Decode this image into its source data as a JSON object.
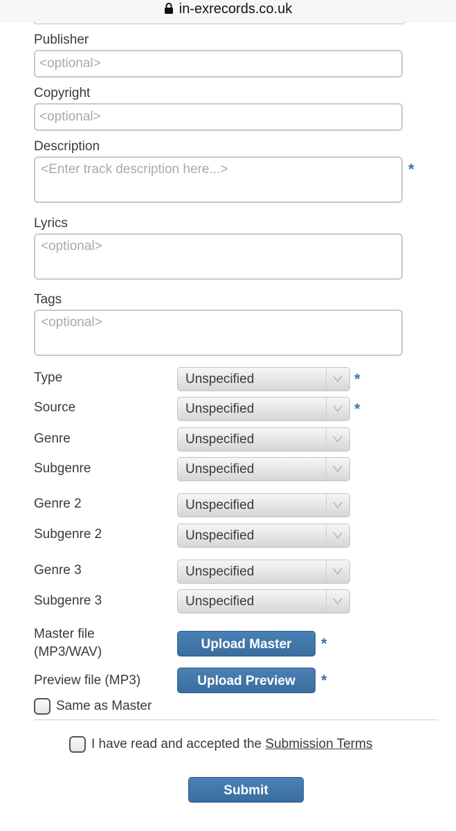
{
  "browser": {
    "url": "in-exrecords.co.uk"
  },
  "form": {
    "publisher": {
      "label": "Publisher",
      "placeholder": "<optional>"
    },
    "copyright": {
      "label": "Copyright",
      "placeholder": "<optional>"
    },
    "description": {
      "label": "Description",
      "placeholder": "<Enter track description here...>",
      "required_mark": "*"
    },
    "lyrics": {
      "label": "Lyrics",
      "placeholder": "<optional>"
    },
    "tags": {
      "label": "Tags",
      "placeholder": "<optional>"
    },
    "type": {
      "label": "Type",
      "value": "Unspecified",
      "required_mark": "*"
    },
    "source": {
      "label": "Source",
      "value": "Unspecified",
      "required_mark": "*"
    },
    "genre": {
      "label": "Genre",
      "value": "Unspecified"
    },
    "subgenre": {
      "label": "Subgenre",
      "value": "Unspecified"
    },
    "genre2": {
      "label": "Genre 2",
      "value": "Unspecified"
    },
    "subgenre2": {
      "label": "Subgenre 2",
      "value": "Unspecified"
    },
    "genre3": {
      "label": "Genre 3",
      "value": "Unspecified"
    },
    "subgenre3": {
      "label": "Subgenre 3",
      "value": "Unspecified"
    },
    "master": {
      "label_line1": "Master file",
      "label_line2": "(MP3/WAV)",
      "button": "Upload Master",
      "required_mark": "*"
    },
    "preview": {
      "label": "Preview file (MP3)",
      "button": "Upload Preview",
      "required_mark": "*"
    },
    "same_as_master": {
      "label": "Same as Master",
      "checked": false
    },
    "terms": {
      "prefix": "I have read and accepted the",
      "link": "Submission Terms",
      "checked": false
    },
    "submit": {
      "label": "Submit"
    }
  },
  "colors": {
    "accent": "#3d72a8",
    "button": "#4277aa"
  }
}
